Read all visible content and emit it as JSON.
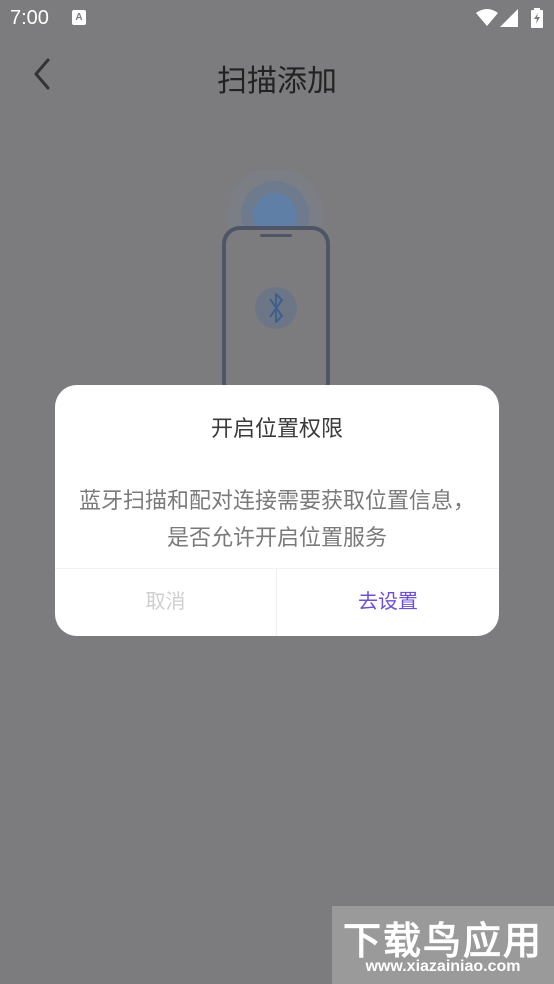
{
  "status_bar": {
    "time": "7:00",
    "notification_icon_letter": "A"
  },
  "header": {
    "title": "扫描添加",
    "back_icon": "chevron-left-icon"
  },
  "illustration": {
    "icon": "bluetooth-icon"
  },
  "dialog": {
    "title": "开启位置权限",
    "message": "蓝牙扫描和配对连接需要获取位置信息，是否允许开启位置服务",
    "cancel_label": "取消",
    "confirm_label": "去设置",
    "confirm_color": "#6a4fd8"
  },
  "watermark": {
    "name": "下载鸟应用",
    "url": "www.xiazainiao.com"
  }
}
